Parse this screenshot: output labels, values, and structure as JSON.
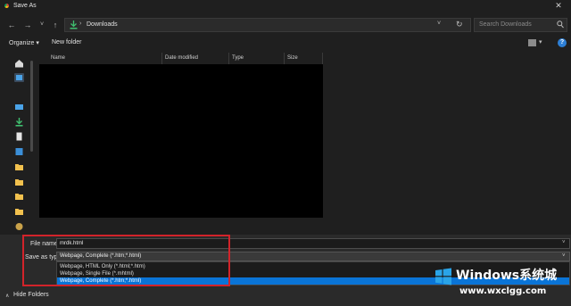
{
  "window": {
    "title": "Save As",
    "close_glyph": "✕"
  },
  "nav": {
    "back_icon": "arrow-left-icon",
    "forward_icon": "arrow-right-icon",
    "recent_icon": "chevron-down-icon",
    "up_icon": "arrow-up-icon",
    "address_separator": "›",
    "address_path": "Downloads",
    "search_placeholder": "Search Downloads"
  },
  "toolbar": {
    "organize_label": "Organize ▾",
    "new_folder_label": "New folder"
  },
  "columns": [
    "Name",
    "Date modified",
    "Type",
    "Size"
  ],
  "form": {
    "file_name_label": "File name:",
    "file_name_value": "mrdk.html",
    "save_as_type_label": "Save as type:",
    "save_as_type_value": "Webpage, Complete (*.htm;*.html)",
    "type_options": [
      "Webpage, HTML Only (*.html;*.htm)",
      "Webpage, Single File (*.mhtml)",
      "Webpage, Complete (*.htm;*.html)"
    ],
    "selected_option_index": 2
  },
  "footer": {
    "hide_folders_label": "Hide Folders"
  },
  "watermark": {
    "main": "Windows系统城",
    "sub": "www.wxclgg.com"
  },
  "colors": {
    "accent": "#0a74d6",
    "highlight_box": "#d2232a",
    "background": "#1f1f1f",
    "file_area": "#000000"
  }
}
